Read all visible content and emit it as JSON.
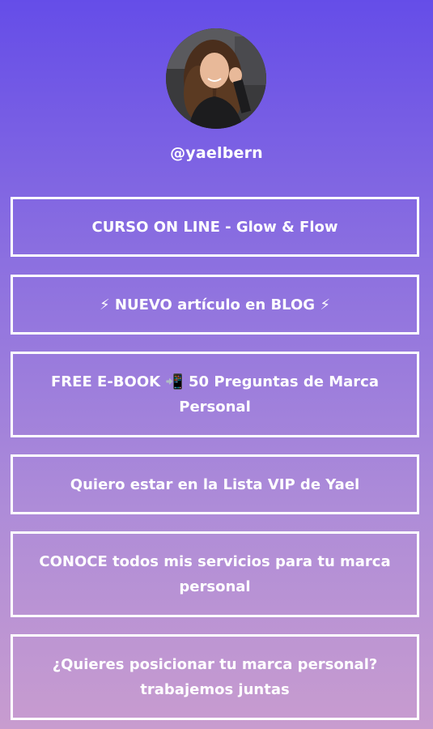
{
  "profile": {
    "handle": "@yaelbern"
  },
  "links": [
    {
      "label": "CURSO ON LINE - Glow & Flow"
    },
    {
      "label": "⚡ NUEVO artículo en BLOG ⚡"
    },
    {
      "label": "FREE E-BOOK 📲 50 Preguntas de Marca Personal"
    },
    {
      "label": "Quiero estar en la Lista VIP de Yael"
    },
    {
      "label": "CONOCE todos mis servicios para tu marca personal"
    },
    {
      "label": "¿Quieres posicionar tu marca personal? trabajemos juntas"
    }
  ]
}
